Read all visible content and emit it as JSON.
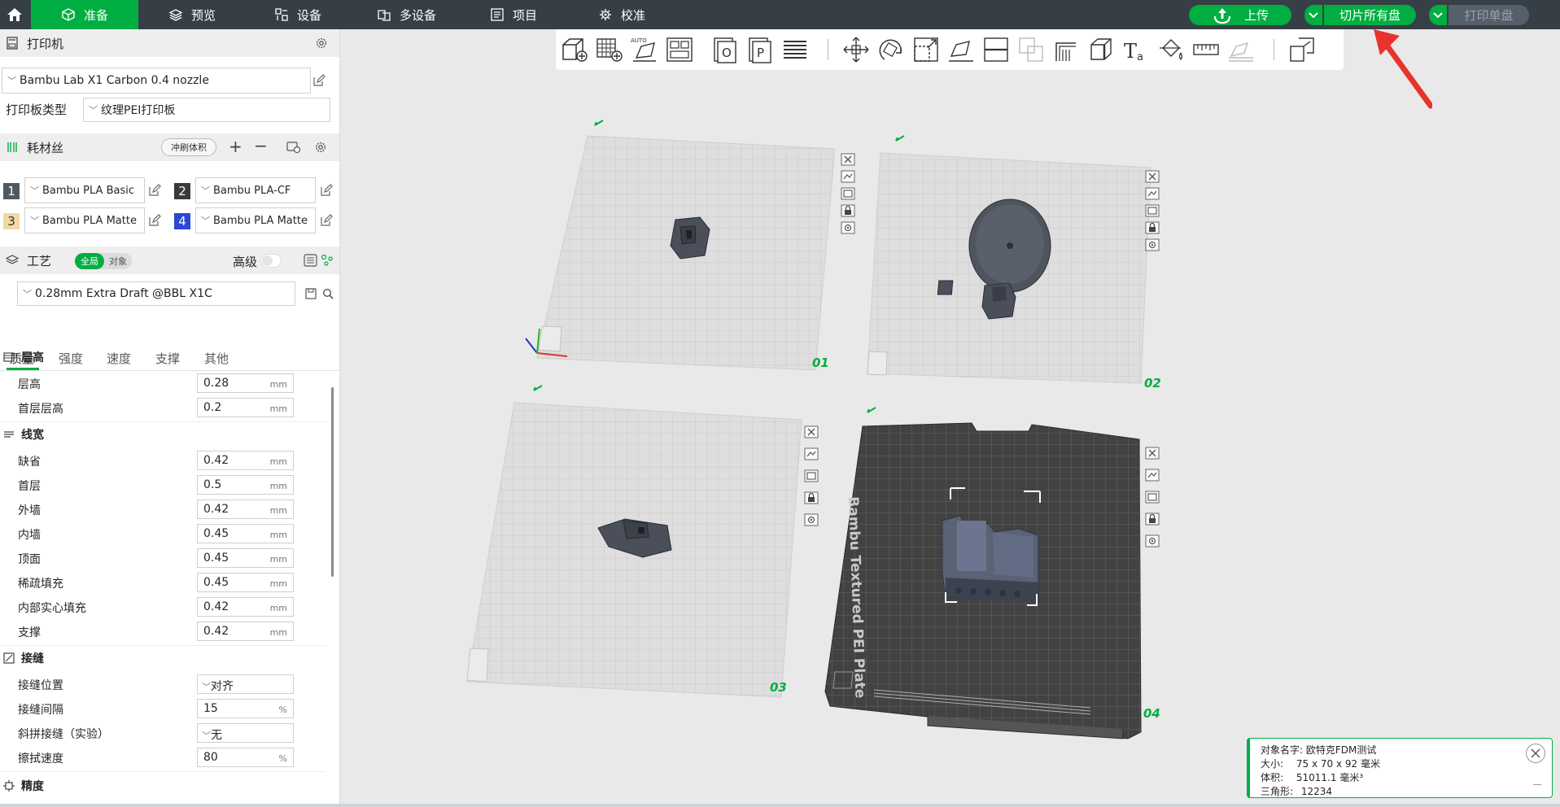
{
  "topbar": {
    "tabs": [
      {
        "label": "准备",
        "icon": "cube-icon",
        "active": true
      },
      {
        "label": "预览",
        "icon": "layers-icon",
        "active": false
      },
      {
        "label": "设备",
        "icon": "device-icon",
        "active": false
      },
      {
        "label": "多设备",
        "icon": "multi-device-icon",
        "active": false
      },
      {
        "label": "项目",
        "icon": "project-icon",
        "active": false
      },
      {
        "label": "校准",
        "icon": "calibration-icon",
        "active": false
      }
    ],
    "upload_label": "上传",
    "slice_all_label": "切片所有盘",
    "print_single_label": "打印单盘"
  },
  "printer": {
    "section_title": "打印机",
    "printer_name": "Bambu Lab X1 Carbon 0.4 nozzle",
    "plate_type_label": "打印板类型",
    "plate_type_value": "纹理PEI打印板"
  },
  "filament": {
    "section_title": "耗材丝",
    "flush_label": "冲刷体积",
    "slots": [
      {
        "num": "1",
        "name": "Bambu PLA Basic",
        "color": "#4d5a66"
      },
      {
        "num": "2",
        "name": "Bambu PLA-CF",
        "color": "#3a3a3a"
      },
      {
        "num": "3",
        "name": "Bambu PLA Matte",
        "color": "#f2d8a4"
      },
      {
        "num": "4",
        "name": "Bambu PLA Matte",
        "color": "#2b48d6"
      }
    ]
  },
  "process": {
    "section_title": "工艺",
    "toggle_global": "全局",
    "toggle_object": "对象",
    "advanced_label": "高级",
    "preset": "0.28mm Extra Draft @BBL X1C",
    "subtabs": [
      "质量",
      "强度",
      "速度",
      "支撑",
      "其他"
    ],
    "groups": {
      "layer_height": {
        "title": "层高",
        "rows": [
          {
            "label": "层高",
            "value": "0.28",
            "unit": "mm"
          },
          {
            "label": "首层层高",
            "value": "0.2",
            "unit": "mm"
          }
        ]
      },
      "line_width": {
        "title": "线宽",
        "rows": [
          {
            "label": "缺省",
            "value": "0.42",
            "unit": "mm"
          },
          {
            "label": "首层",
            "value": "0.5",
            "unit": "mm"
          },
          {
            "label": "外墙",
            "value": "0.42",
            "unit": "mm"
          },
          {
            "label": "内墙",
            "value": "0.45",
            "unit": "mm"
          },
          {
            "label": "顶面",
            "value": "0.45",
            "unit": "mm"
          },
          {
            "label": "稀疏填充",
            "value": "0.45",
            "unit": "mm"
          },
          {
            "label": "内部实心填充",
            "value": "0.42",
            "unit": "mm"
          },
          {
            "label": "支撑",
            "value": "0.42",
            "unit": "mm"
          }
        ]
      },
      "seam": {
        "title": "接缝",
        "rows": [
          {
            "label": "接缝位置",
            "value": "对齐",
            "unit": ""
          },
          {
            "label": "接缝间隔",
            "value": "15",
            "unit": "%"
          },
          {
            "label": "斜拼接缝（实验）",
            "value": "无",
            "unit": ""
          },
          {
            "label": "擦拭速度",
            "value": "80",
            "unit": "%"
          }
        ]
      },
      "precision": {
        "title": "精度"
      }
    }
  },
  "plates": [
    {
      "num": "01"
    },
    {
      "num": "02"
    },
    {
      "num": "03"
    },
    {
      "num": "04"
    }
  ],
  "plate4_bed_text": "Bambu Textured PEI Plate",
  "info": {
    "name_label": "对象名字:",
    "name_value": "欧特克FDM测试",
    "size_label": "大小:",
    "size_value": "75 x 70 x 92 毫米",
    "volume_label": "体积:",
    "volume_value": "51011.1 毫米³",
    "triangles_label": "三角形:",
    "triangles_value": "12234"
  },
  "colors": {
    "accent": "#00ae42",
    "topbar": "#363f45",
    "annotation": "#e8332c"
  }
}
